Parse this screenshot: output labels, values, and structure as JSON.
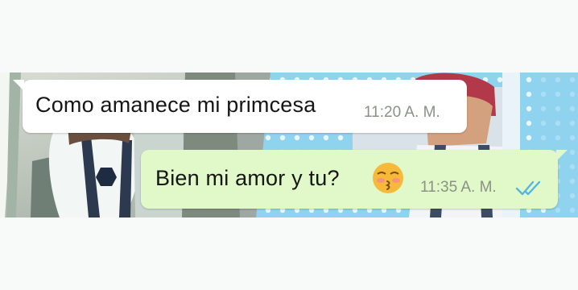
{
  "chat": {
    "messages": [
      {
        "direction": "incoming",
        "text": "Como amanece mi primcesa",
        "time": "11:20 A. M."
      },
      {
        "direction": "outgoing",
        "text": "Bien mi amor y tu?",
        "emoji": "kissing-face-with-closed-eyes",
        "time": "11:35 A. M.",
        "status": "read-double-check"
      }
    ]
  },
  "colors": {
    "incoming_bubble": "#ffffff",
    "outgoing_bubble": "#e1f8c8",
    "timestamp": "#8a9286",
    "read_check": "#4fb6e6",
    "wallpaper_polka": "#8fd3ef"
  }
}
